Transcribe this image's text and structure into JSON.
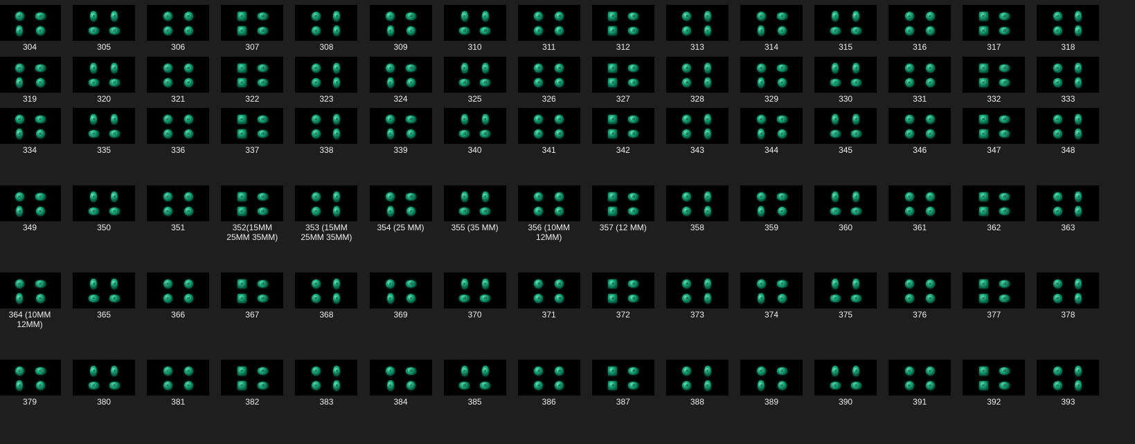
{
  "colors": {
    "background": "#1e1e1e",
    "thumbnail_bg": "#000000",
    "bead_green": "#1fb585",
    "label_text": "#ececec"
  },
  "thumbnail_icon": "green-bead-thumbnail-icon",
  "rows": [
    {
      "items": [
        "304",
        "305",
        "306",
        "307",
        "308",
        "309",
        "310",
        "311",
        "312",
        "313",
        "314",
        "315",
        "316",
        "317",
        "318"
      ]
    },
    {
      "items": [
        "319",
        "320",
        "321",
        "322",
        "323",
        "324",
        "325",
        "326",
        "327",
        "328",
        "329",
        "330",
        "331",
        "332",
        "333"
      ]
    },
    {
      "items": [
        "334",
        "335",
        "336",
        "337",
        "338",
        "339",
        "340",
        "341",
        "342",
        "343",
        "344",
        "345",
        "346",
        "347",
        "348"
      ]
    },
    {
      "items": [
        "349",
        "350",
        "351",
        "352(15MM\n25MM 35MM)",
        "353 (15MM\n25MM 35MM)",
        "354 (25 MM)",
        "355 (35 MM)",
        "356 (10MM\n12MM)",
        "357 (12 MM)",
        "358",
        "359",
        "360",
        "361",
        "362",
        "363"
      ]
    },
    {
      "items": [
        "364 (10MM\n12MM)",
        "365",
        "366",
        "367",
        "368",
        "369",
        "370",
        "371",
        "372",
        "373",
        "374",
        "375",
        "376",
        "377",
        "378"
      ]
    },
    {
      "items": [
        "379",
        "380",
        "381",
        "382",
        "383",
        "384",
        "385",
        "386",
        "387",
        "388",
        "389",
        "390",
        "391",
        "392",
        "393"
      ]
    }
  ]
}
